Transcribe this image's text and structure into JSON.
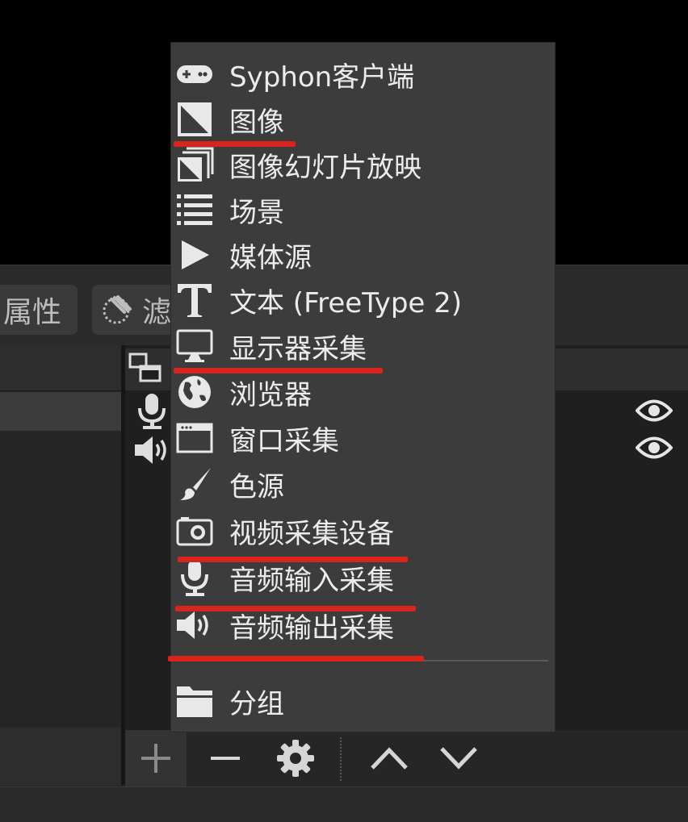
{
  "toolbar": {
    "properties_label": "属性",
    "filters_label": "滤",
    "properties_icon": "gear-icon",
    "filters_icon": "filter-icon"
  },
  "sources_header_icon": "scene-copy-icon",
  "sources": [
    {
      "icon": "microphone-icon",
      "visible_icon": "eye-icon"
    },
    {
      "icon": "speaker-icon",
      "visible_icon": "eye-icon"
    }
  ],
  "source_controls": {
    "add": "plus-icon",
    "remove": "minus-icon",
    "settings": "gear-icon",
    "move_up": "chevron-up-icon",
    "move_down": "chevron-down-icon"
  },
  "menu": {
    "items": [
      {
        "label": "Syphon客户端",
        "icon": "gamepad-icon"
      },
      {
        "label": "图像",
        "icon": "image-icon"
      },
      {
        "label": "图像幻灯片放映",
        "icon": "slideshow-icon"
      },
      {
        "label": "场景",
        "icon": "list-icon"
      },
      {
        "label": "媒体源",
        "icon": "play-icon"
      },
      {
        "label": "文本 (FreeType 2)",
        "icon": "text-icon"
      },
      {
        "label": "显示器采集",
        "icon": "monitor-icon"
      },
      {
        "label": "浏览器",
        "icon": "globe-icon"
      },
      {
        "label": "窗口采集",
        "icon": "window-icon"
      },
      {
        "label": "色源",
        "icon": "brush-icon"
      },
      {
        "label": "视频采集设备",
        "icon": "camera-icon"
      },
      {
        "label": "音频输入采集",
        "icon": "microphone-icon"
      },
      {
        "label": "音频输出采集",
        "icon": "speaker-icon"
      }
    ],
    "group": {
      "label": "分组",
      "icon": "folder-icon"
    }
  },
  "highlight_color": "#d9231b"
}
